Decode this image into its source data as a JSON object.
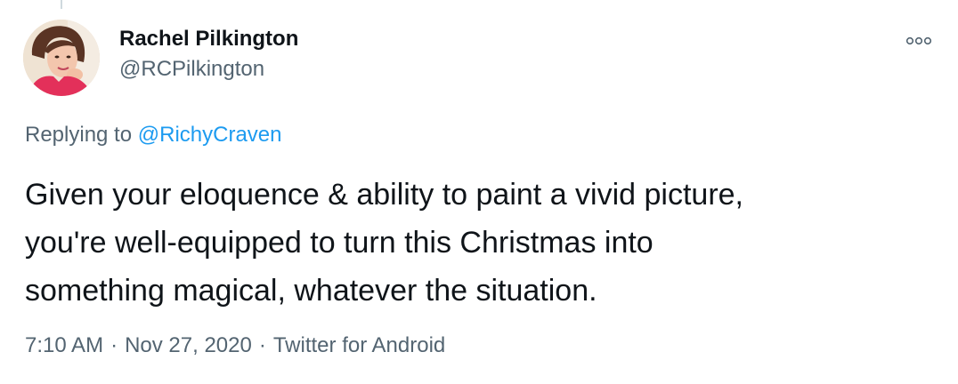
{
  "author": {
    "name": "Rachel Pilkington",
    "handle": "@RCPilkington"
  },
  "reply": {
    "prefix": "Replying to ",
    "mention": "@RichyCraven"
  },
  "tweet": {
    "lines": [
      "Given your eloquence & ability to paint a vivid picture,",
      "you're well-equipped to turn this Christmas into",
      "something magical, whatever the situation."
    ]
  },
  "meta": {
    "time": "7:10 AM",
    "separator": "·",
    "date": "Nov 27, 2020",
    "source": "Twitter for Android"
  },
  "icons": {
    "more": "more-options-icon",
    "avatar": "profile-photo"
  },
  "colors": {
    "accent": "#1d9bf0",
    "text": "#0f1419",
    "secondary": "#536471"
  }
}
